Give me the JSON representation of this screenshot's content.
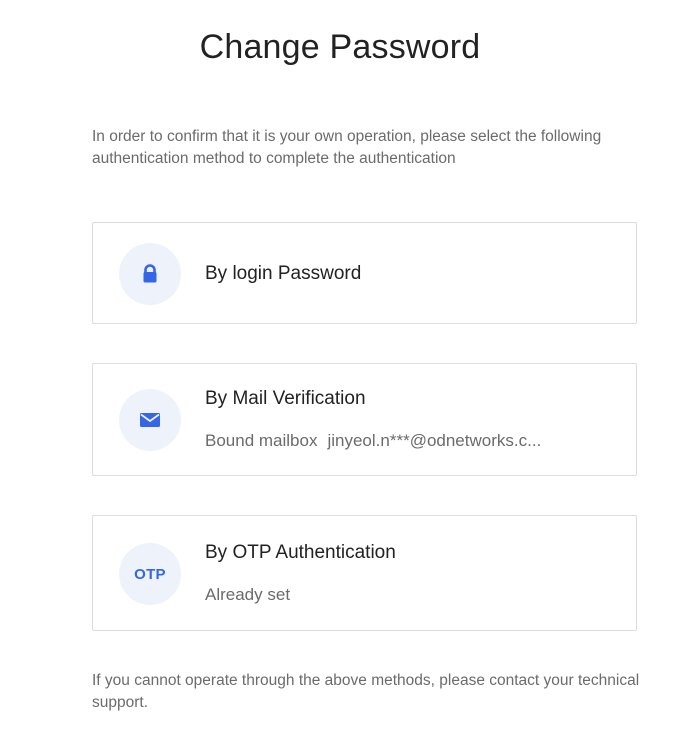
{
  "page": {
    "title": "Change Password",
    "intro": "In order to confirm that it is your own operation, please select the following authentication method to complete the authentication",
    "footer": "If you cannot operate through the above methods, please contact your technical support."
  },
  "methods": {
    "password": {
      "icon": "lock-icon",
      "title": "By login Password"
    },
    "mail": {
      "icon": "mail-icon",
      "title": "By Mail Verification",
      "sub_label": "Bound mailbox",
      "sub_value": "jinyeol.n***@odnetworks.c..."
    },
    "otp": {
      "icon_text": "OTP",
      "title": "By OTP Authentication",
      "status": "Already set"
    }
  },
  "colors": {
    "accent": "#3566e6",
    "icon_bg": "#eef2fb",
    "border": "#dcdcdc",
    "muted_text": "#6b6b6b"
  }
}
